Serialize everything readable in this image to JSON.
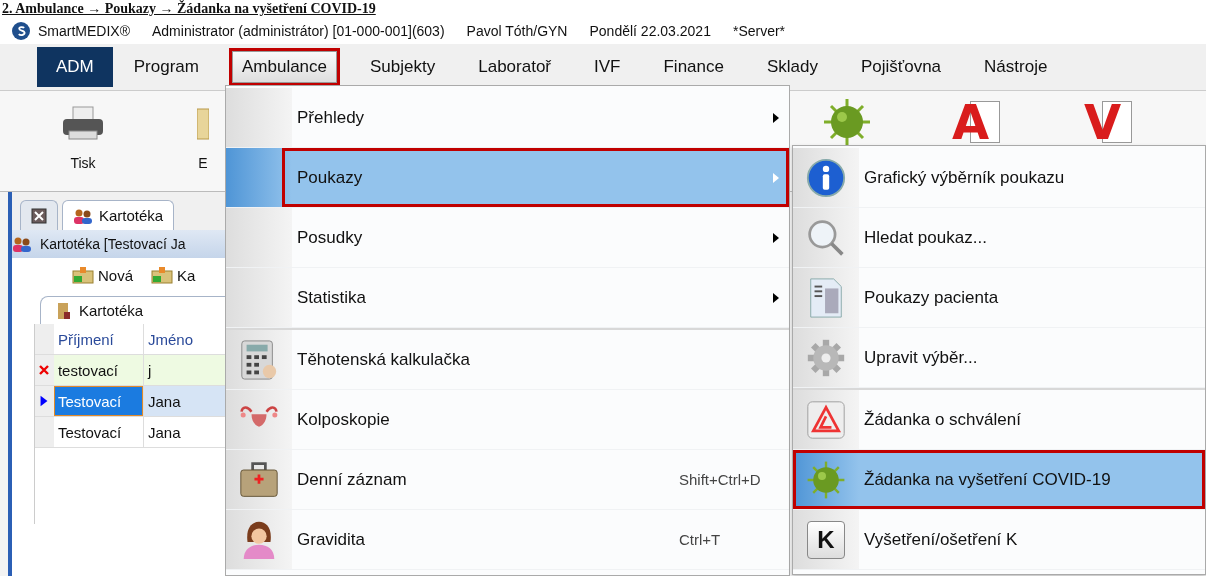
{
  "caption": "2. Ambulance → Poukazy → Žádanka na vyšetření COVID-19",
  "title_bar": {
    "app": "SmartMEDIX®",
    "user": "Administrator (administrátor) [01-000-001](603)",
    "doctor": "Pavol Tóth/GYN",
    "date": "Pondělí 22.03.2021",
    "server": "*Server*"
  },
  "menu_bar": [
    {
      "label": "ADM",
      "kind": "badge",
      "selected": false,
      "highlighted": false
    },
    {
      "label": "Program",
      "kind": "menu",
      "selected": false,
      "highlighted": false
    },
    {
      "label": "Ambulance",
      "kind": "menu",
      "selected": true,
      "highlighted": true
    },
    {
      "label": "Subjekty",
      "kind": "menu",
      "selected": false,
      "highlighted": false
    },
    {
      "label": "Laboratoř",
      "kind": "menu",
      "selected": false,
      "highlighted": false
    },
    {
      "label": "IVF",
      "kind": "menu",
      "selected": false,
      "highlighted": false
    },
    {
      "label": "Finance",
      "kind": "menu",
      "selected": false,
      "highlighted": false
    },
    {
      "label": "Sklady",
      "kind": "menu",
      "selected": false,
      "highlighted": false
    },
    {
      "label": "Pojišťovna",
      "kind": "menu",
      "selected": false,
      "highlighted": false
    },
    {
      "label": "Nástroje",
      "kind": "menu",
      "selected": false,
      "highlighted": false
    }
  ],
  "ribbon": {
    "buttons": [
      {
        "label": "Tisk"
      },
      {
        "label": "E"
      }
    ],
    "tools": [
      {
        "kind": "image"
      },
      {
        "kind": "letter",
        "letter": "A"
      },
      {
        "kind": "letter",
        "letter": "V"
      }
    ]
  },
  "left_panel": {
    "tabs": [
      {
        "kind": "close",
        "selected": false
      },
      {
        "kind": "tab",
        "label": "Kartotéka",
        "selected": true
      }
    ],
    "panel_title": "Kartotéka [Testovací Ja",
    "toolbar": [
      "Nová",
      "Ka"
    ],
    "inner_tab": "Kartotéka",
    "grid": {
      "columns": [
        "Příjmení",
        "Jméno"
      ],
      "rows": [
        {
          "kind": "error",
          "selected": false,
          "cells": [
            "testovací",
            "j"
          ]
        },
        {
          "kind": "current",
          "selected": true,
          "cells": [
            "Testovací",
            "Jana"
          ]
        },
        {
          "kind": "plain",
          "selected": false,
          "cells": [
            "Testovací",
            "Jana"
          ]
        }
      ]
    }
  },
  "ambulance_menu": [
    {
      "label": "Přehledy",
      "kind": "submenu",
      "selected": false,
      "highlighted": false
    },
    {
      "label": "Poukazy",
      "kind": "submenu",
      "selected": true,
      "highlighted": true
    },
    {
      "label": "Posudky",
      "kind": "submenu",
      "selected": false,
      "highlighted": false
    },
    {
      "label": "Statistika",
      "kind": "submenu",
      "selected": false,
      "highlighted": false
    },
    {
      "label": "Těhotenská kalkulačka",
      "kind": "command",
      "selected": false,
      "highlighted": false
    },
    {
      "label": "Kolposkopie",
      "kind": "command",
      "selected": false,
      "highlighted": false
    },
    {
      "label": "Denní záznam",
      "kind": "command",
      "shortcut": "Shift+Ctrl+D",
      "selected": false,
      "highlighted": false
    },
    {
      "label": "Gravidita",
      "kind": "command",
      "shortcut": "Ctrl+T",
      "selected": false,
      "highlighted": false
    }
  ],
  "poukazy_submenu": [
    {
      "label": "Grafický výběrník poukazu",
      "selected": false,
      "highlighted": false
    },
    {
      "label": "Hledat poukaz...",
      "selected": false,
      "highlighted": false
    },
    {
      "label": "Poukazy pacienta",
      "selected": false,
      "highlighted": false
    },
    {
      "label": "Upravit výběr...",
      "selected": false,
      "highlighted": false
    },
    {
      "label": "Žádanka o schválení",
      "selected": false,
      "highlighted": false
    },
    {
      "label": "Žádanka na vyšetření COVID-19",
      "selected": true,
      "highlighted": true
    },
    {
      "label": "Vyšetření/ošetření K",
      "key": "K",
      "selected": false,
      "highlighted": false
    }
  ]
}
